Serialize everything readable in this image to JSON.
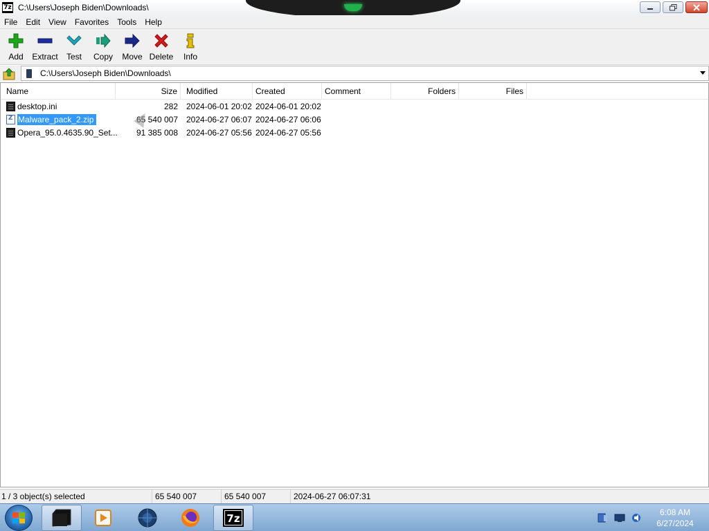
{
  "window": {
    "title": "C:\\Users\\Joseph Biden\\Downloads\\",
    "app_icon_label": "7z"
  },
  "menu": [
    "File",
    "Edit",
    "View",
    "Favorites",
    "Tools",
    "Help"
  ],
  "toolbar": [
    {
      "label": "Add",
      "icon": "plus-icon",
      "color": "#1ea51e"
    },
    {
      "label": "Extract",
      "icon": "minus-icon",
      "color": "#1e2c9c"
    },
    {
      "label": "Test",
      "icon": "check-icon",
      "color": "#22a5b8"
    },
    {
      "label": "Copy",
      "icon": "double-arrow-right-icon",
      "color": "#1f9c7a"
    },
    {
      "label": "Move",
      "icon": "arrow-right-icon",
      "color": "#1b2a88"
    },
    {
      "label": "Delete",
      "icon": "x-icon",
      "color": "#d01b1b"
    },
    {
      "label": "Info",
      "icon": "info-icon",
      "color": "#c9a400"
    }
  ],
  "address": {
    "path": "C:\\Users\\Joseph Biden\\Downloads\\"
  },
  "columns": [
    "Name",
    "Size",
    "Modified",
    "Created",
    "Comment",
    "Folders",
    "Files"
  ],
  "files": [
    {
      "name": "desktop.ini",
      "size": "282",
      "modified": "2024-06-01 20:02",
      "created": "2024-06-01 20:02",
      "icon": "ini-file-icon",
      "selected": false
    },
    {
      "name": "Malware_pack_2.zip",
      "size": "65 540 007",
      "modified": "2024-06-27 06:07",
      "created": "2024-06-27 06:06",
      "icon": "zip-file-icon",
      "selected": true
    },
    {
      "name": "Opera_95.0.4635.90_Set...",
      "size": "91 385 008",
      "modified": "2024-06-27 05:56",
      "created": "2024-06-27 05:56",
      "icon": "exe-file-icon",
      "selected": false
    }
  ],
  "status": {
    "selection": "1 / 3 object(s) selected",
    "selected_size": "65 540 007",
    "total_size": "65 540 007",
    "modified": "2024-06-27 06:07:31"
  },
  "taskbar": {
    "apps": [
      "file-explorer-icon",
      "media-player-icon",
      "globe-browser-icon",
      "firefox-icon",
      "7zip-icon"
    ],
    "clock_time": "6:08 AM",
    "clock_date": "6/27/2024",
    "sevenzip_label": "7z"
  },
  "colors": {
    "selection": "#3399ff",
    "taskbar": "#8fb3db"
  }
}
